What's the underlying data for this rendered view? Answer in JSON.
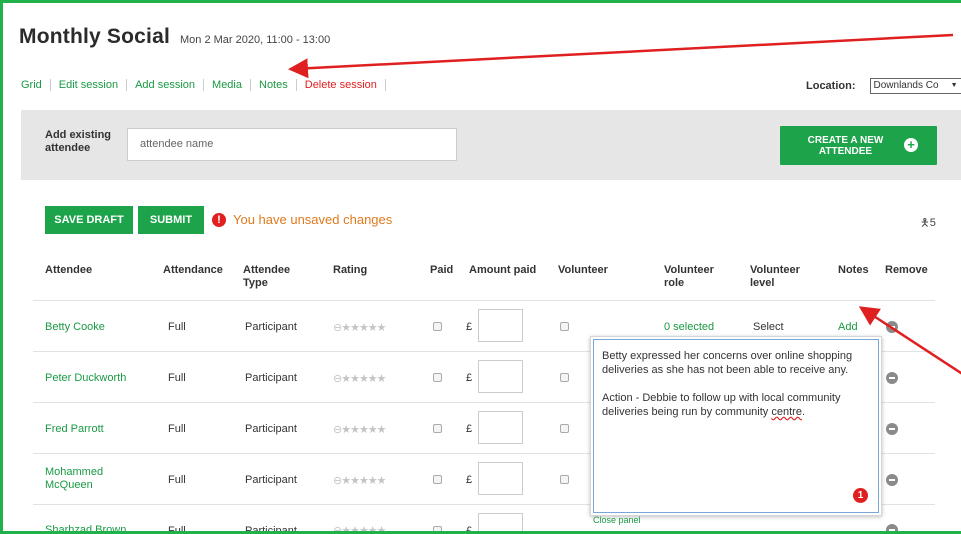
{
  "header": {
    "title": "Monthly Social",
    "datetime": "Mon 2 Mar 2020, 11:00 - 13:00"
  },
  "subnav": {
    "items": [
      "Grid",
      "Edit session",
      "Add session",
      "Media",
      "Notes"
    ],
    "delete": "Delete session"
  },
  "location": {
    "label": "Location:",
    "value": "Downlands Co"
  },
  "add_attendee": {
    "label": "Add existing attendee",
    "placeholder": "attendee name",
    "create_button": "CREATE A NEW ATTENDEE"
  },
  "toolbar": {
    "save_draft": "SAVE DRAFT",
    "submit": "SUBMIT",
    "unsaved": "You have unsaved changes",
    "count": "5"
  },
  "table": {
    "headers": {
      "attendee": "Attendee",
      "attendance": "Attendance",
      "attendee_type": "Attendee Type",
      "rating": "Rating",
      "paid": "Paid",
      "amount_paid": "Amount paid",
      "volunteer": "Volunteer",
      "volunteer_role": "Volunteer role",
      "volunteer_level": "Volunteer level",
      "notes": "Notes",
      "remove": "Remove"
    },
    "currency": "£",
    "rows": [
      {
        "name": "Betty Cooke",
        "attendance": "Full",
        "type": "Participant",
        "role": "0 selected",
        "level": "Select",
        "notes": "Add"
      },
      {
        "name": "Peter Duckworth",
        "attendance": "Full",
        "type": "Participant"
      },
      {
        "name": "Fred Parrott",
        "attendance": "Full",
        "type": "Participant"
      },
      {
        "name": "Mohammed McQueen",
        "attendance": "Full",
        "type": "Participant"
      },
      {
        "name": "Sharhzad Brown",
        "attendance": "Full",
        "type": "Participant"
      }
    ]
  },
  "notes_panel": {
    "para1": "Betty expressed her concerns over online shopping deliveries as she has not been able to receive any.",
    "para2_prefix": "Action - Debbie to follow up with local community deliveries being run by community ",
    "para2_misspelled": "centre",
    "para2_suffix": ".",
    "close": "Close panel",
    "badge": "1"
  },
  "colors": {
    "green": "#1da34a",
    "red": "#e02020",
    "orange": "#e07a1e"
  }
}
